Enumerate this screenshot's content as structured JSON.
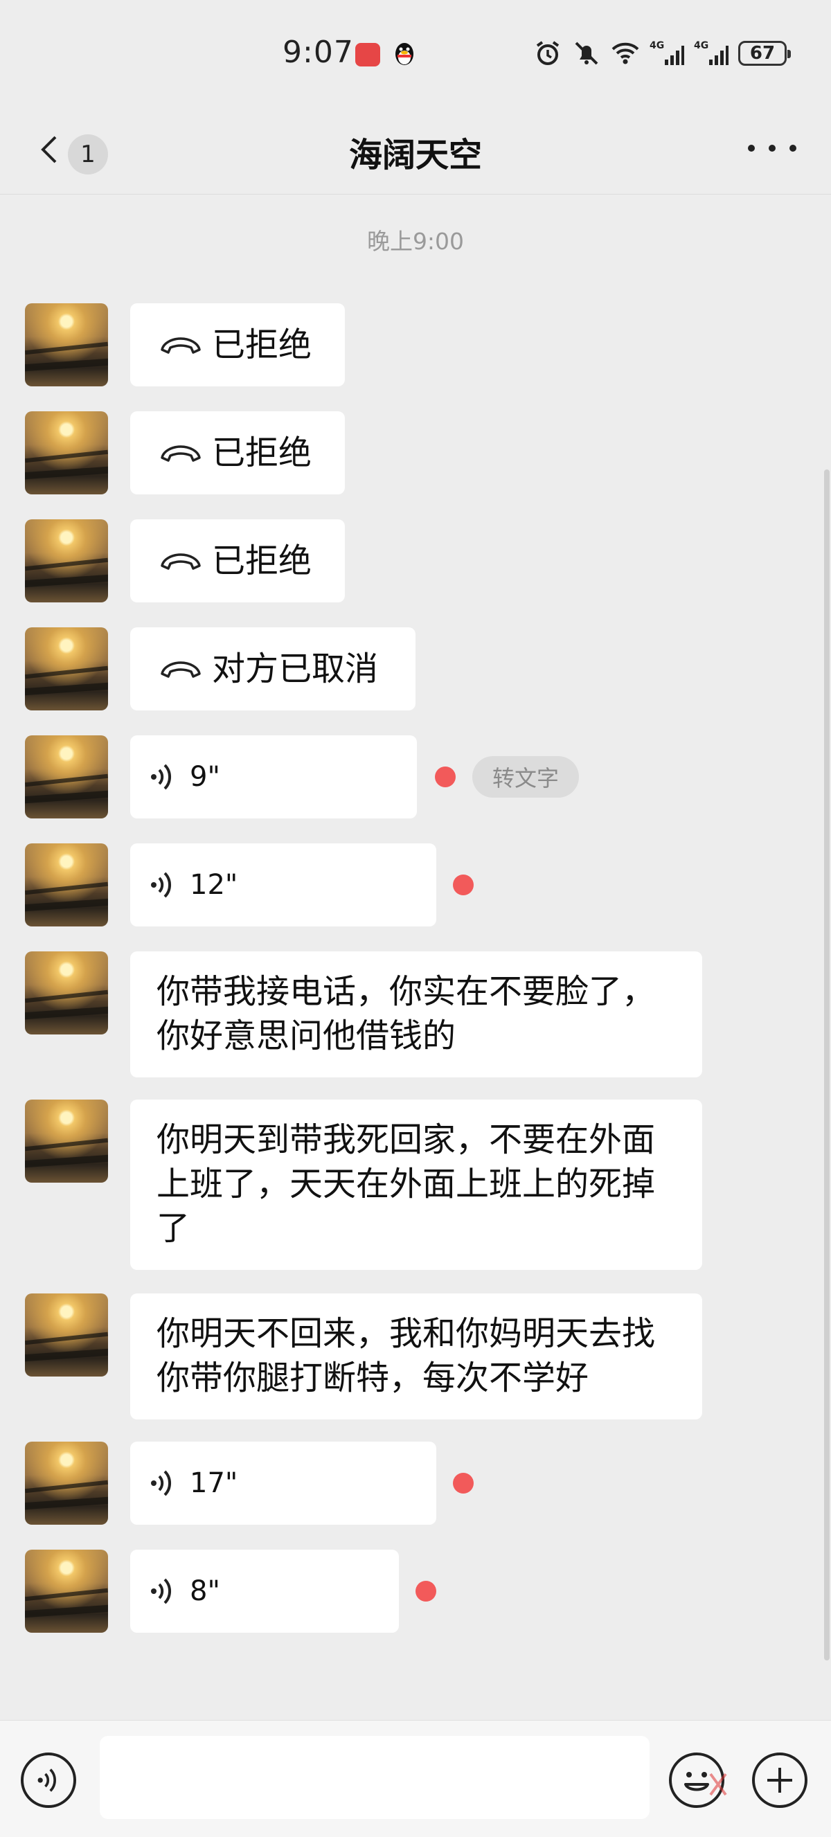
{
  "status_bar": {
    "time": "9:07",
    "network_1": "4G",
    "network_2": "4G",
    "battery": "67"
  },
  "header": {
    "unread_count": "1",
    "title": "海阔天空"
  },
  "chat": {
    "timestamp": "晚上9:00",
    "messages": [
      {
        "type": "call",
        "text": "已拒绝"
      },
      {
        "type": "call",
        "text": "已拒绝"
      },
      {
        "type": "call",
        "text": "已拒绝"
      },
      {
        "type": "call",
        "text": "对方已取消"
      },
      {
        "type": "voice",
        "duration": "9\"",
        "unread": true,
        "transcribe_label": "转文字"
      },
      {
        "type": "voice",
        "duration": "12\"",
        "unread": true
      },
      {
        "type": "text",
        "text": "你带我接电话，你实在不要脸了，你好意思问他借钱的"
      },
      {
        "type": "text",
        "text": "你明天到带我死回家，不要在外面上班了，天天在外面上班上的死掉了"
      },
      {
        "type": "text",
        "text": "你明天不回来，我和你妈明天去找你带你腿打断特，每次不学好"
      },
      {
        "type": "voice",
        "duration": "17\"",
        "unread": true
      },
      {
        "type": "voice",
        "duration": "8\"",
        "unread": true
      }
    ]
  },
  "colors": {
    "background": "#ededed",
    "bubble": "#ffffff",
    "unread_dot": "#f25a5a"
  }
}
